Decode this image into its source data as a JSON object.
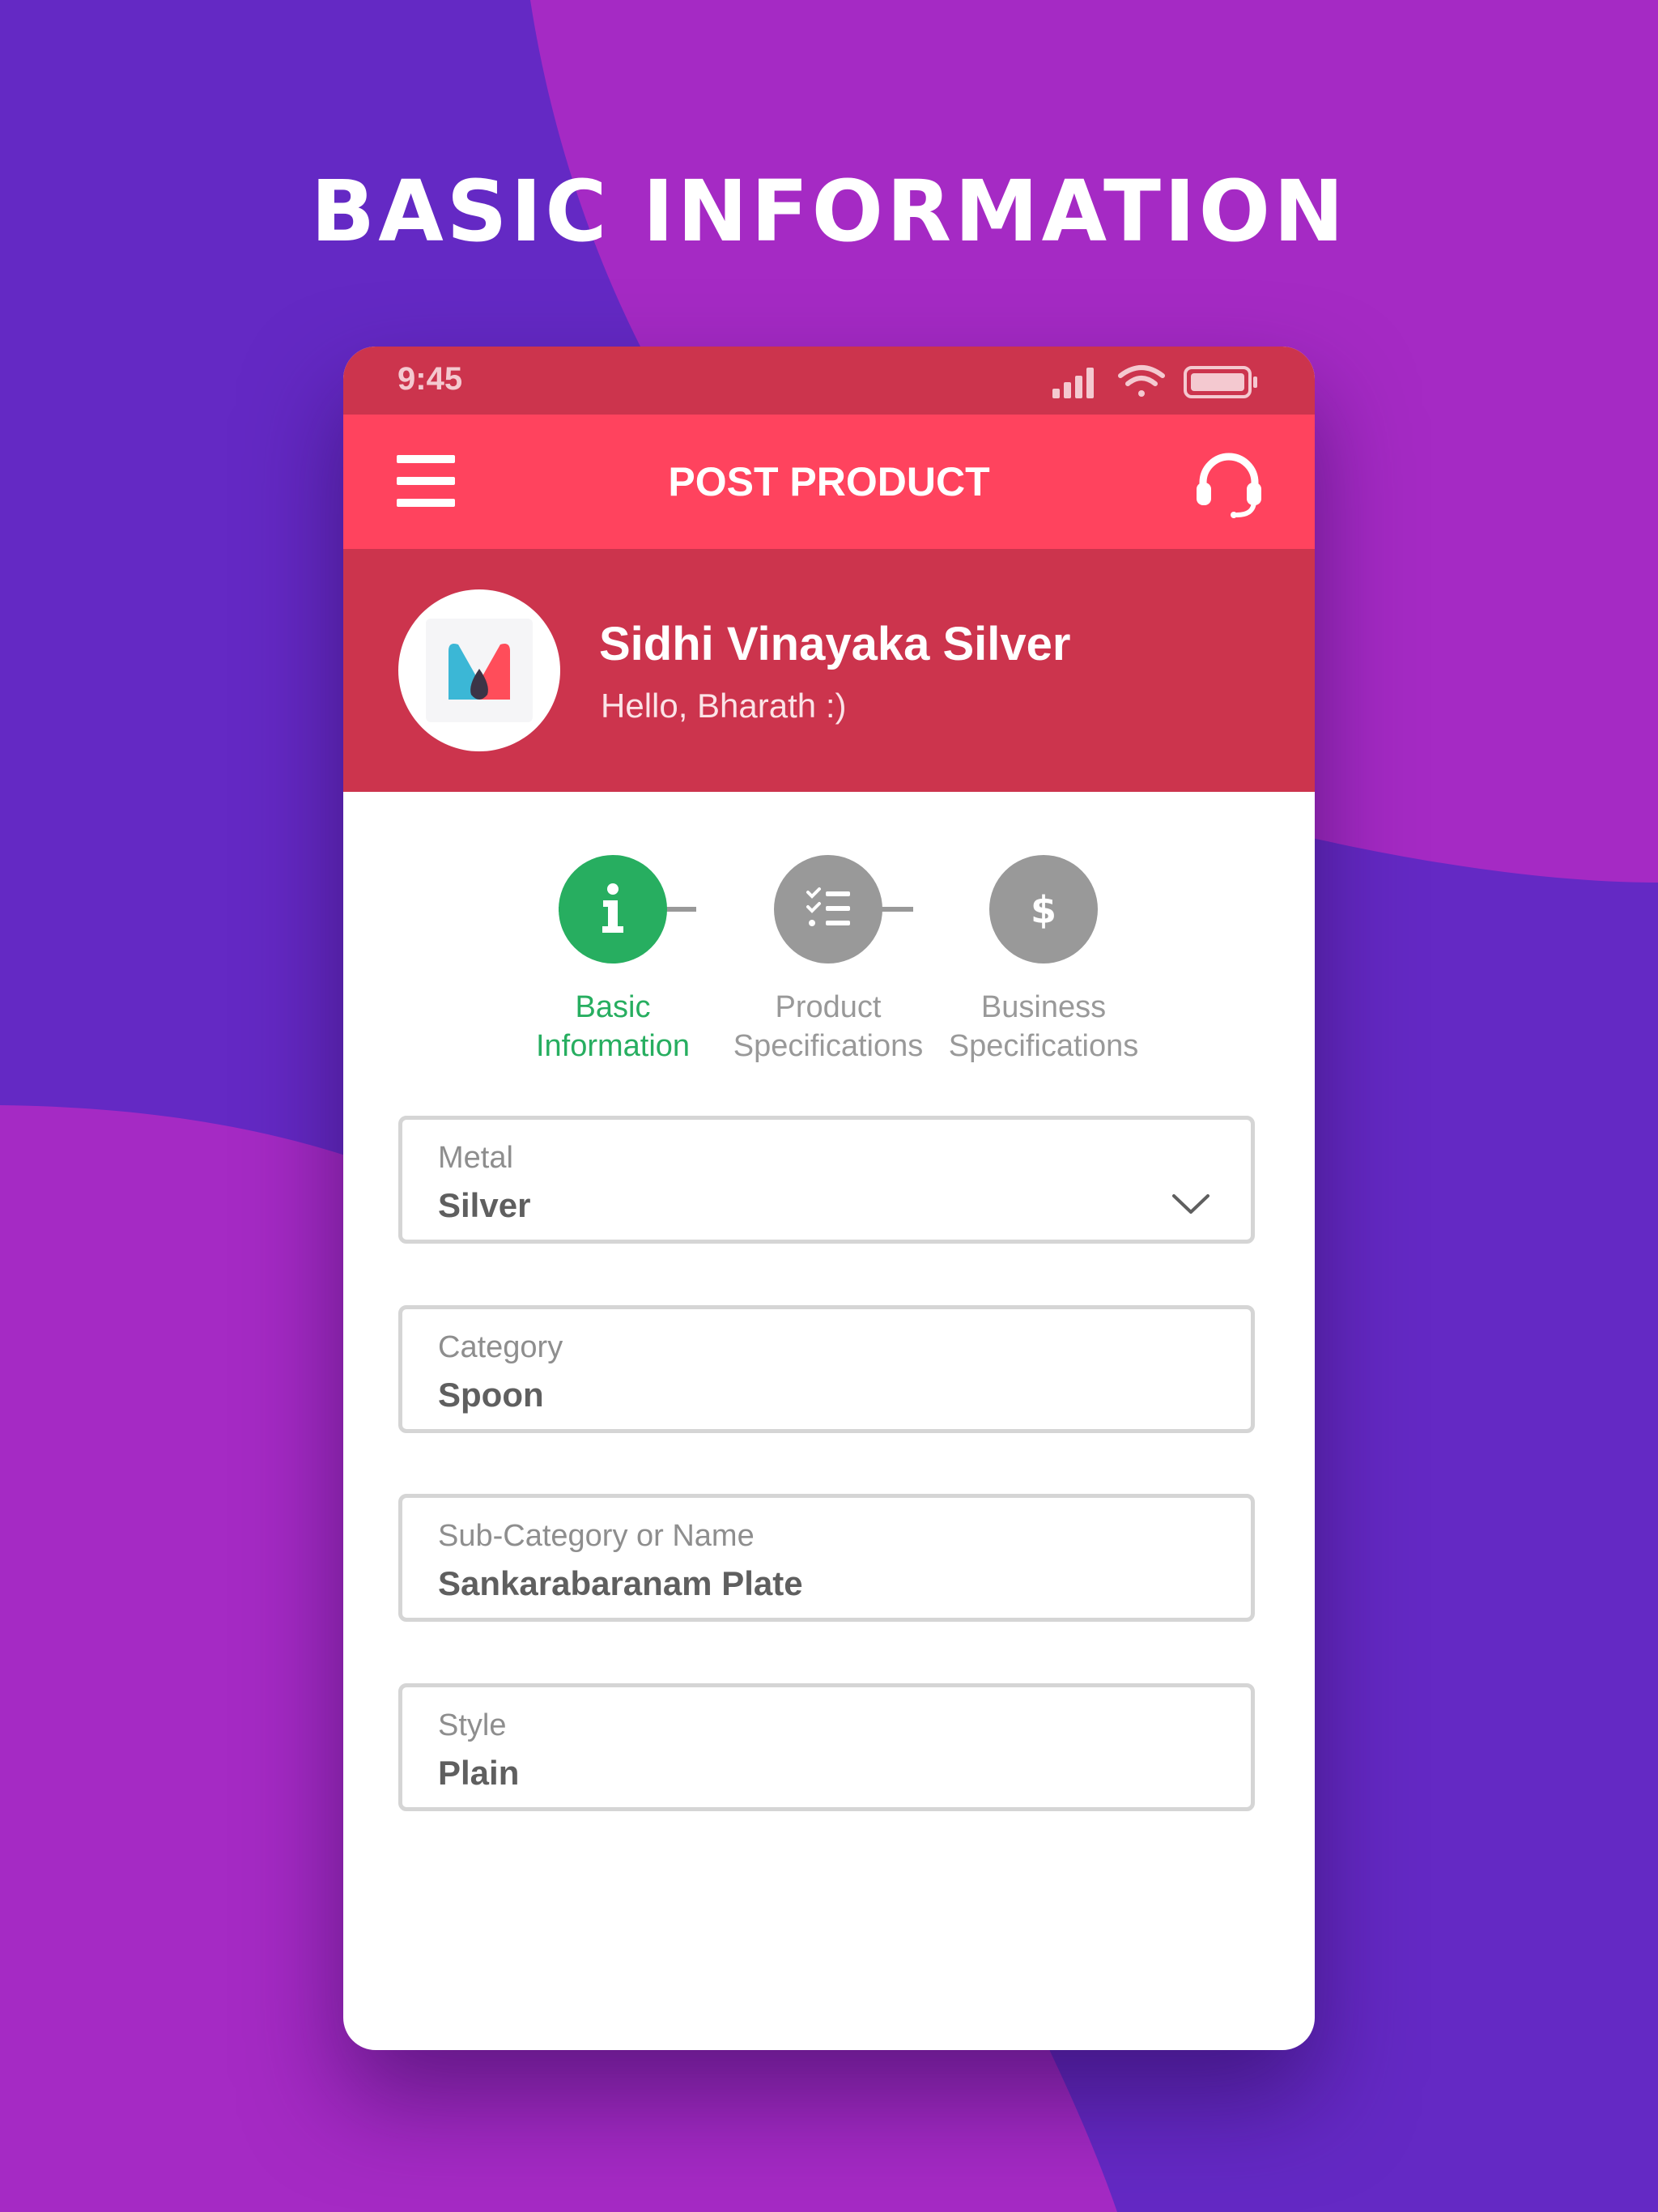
{
  "page": {
    "headline": "BASIC INFORMATION"
  },
  "status_bar": {
    "time": "9:45",
    "icons": [
      "signal-icon",
      "wifi-icon",
      "battery-icon"
    ]
  },
  "app_bar": {
    "title": "POST PRODUCT",
    "left_icon": "hamburger-menu-icon",
    "right_icon": "headset-support-icon"
  },
  "profile": {
    "company_name": "Sidhi Vinayaka Silver",
    "greeting": "Hello, Bharath :)",
    "logo_icon": "m-logo-icon"
  },
  "stepper": {
    "steps": [
      {
        "label_line1": "Basic",
        "label_line2": "Information",
        "icon": "info-icon",
        "state": "active"
      },
      {
        "label_line1": "Product",
        "label_line2": "Specifications",
        "icon": "checklist-icon",
        "state": "inactive"
      },
      {
        "label_line1": "Business",
        "label_line2": "Specifications",
        "icon": "dollar-icon",
        "state": "inactive"
      }
    ]
  },
  "form": {
    "fields": [
      {
        "label": "Metal",
        "value": "Silver",
        "type": "dropdown"
      },
      {
        "label": "Category",
        "value": "Spoon",
        "type": "text"
      },
      {
        "label": "Sub-Category or Name",
        "value": "Sankarabaranam Plate",
        "type": "text"
      },
      {
        "label": "Style",
        "value": "Plain",
        "type": "text"
      }
    ]
  },
  "colors": {
    "background": "#6429c4",
    "background_accent": "#a52ac4",
    "status_bar": "#cc344d",
    "app_bar": "#ff435e",
    "active_step": "#27ae60",
    "inactive_step": "#999999"
  }
}
